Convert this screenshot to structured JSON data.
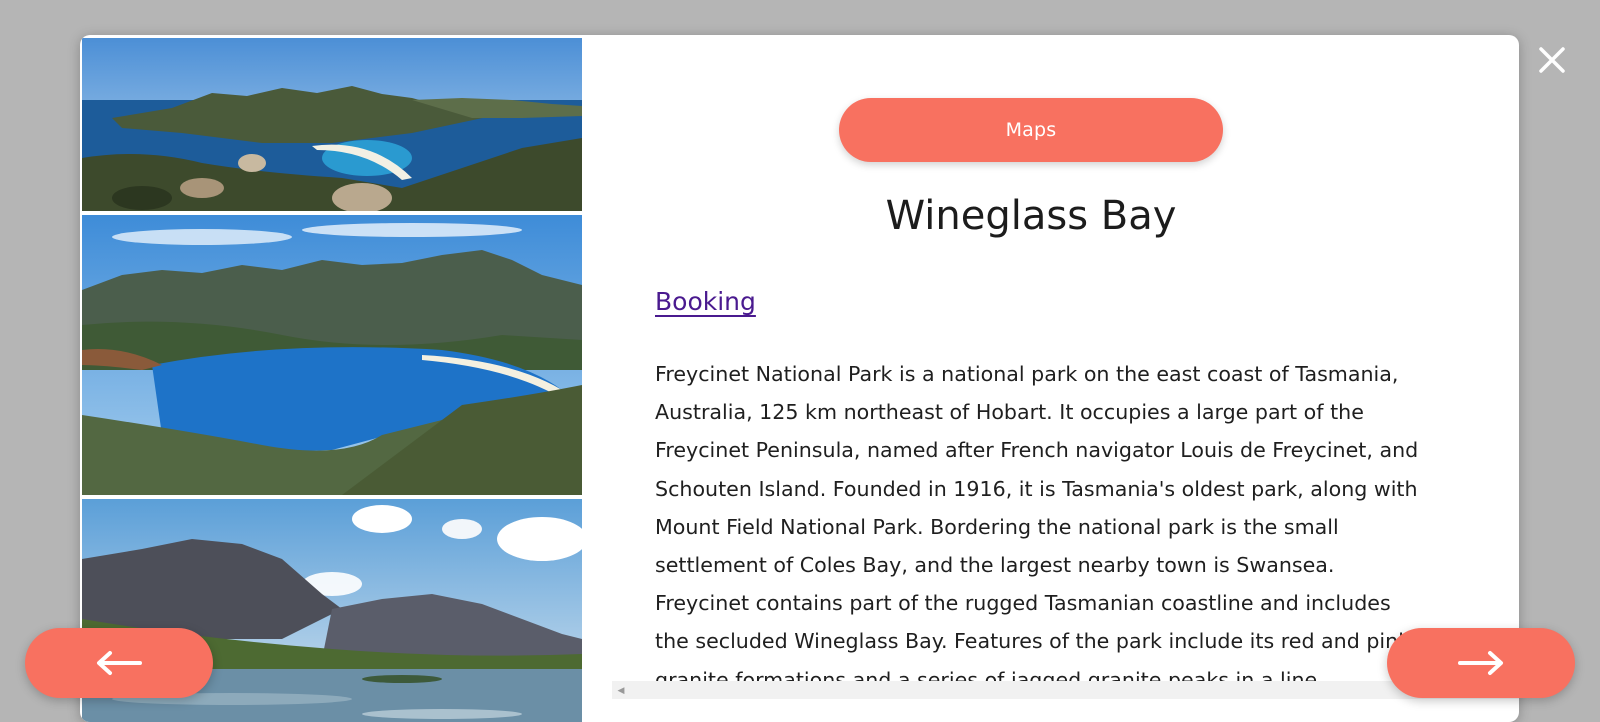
{
  "modal": {
    "maps_label": "Maps",
    "title": "Wineglass Bay",
    "booking_link": "Booking",
    "description": "Freycinet National Park is a national park on the east coast of Tasmania, Australia, 125 km northeast of Hobart. It occupies a large part of the Freycinet Peninsula, named after French navigator Louis de Freycinet, and Schouten Island. Founded in 1916, it is Tasmania's oldest park, along with Mount Field National Park. Bordering the national park is the small settlement of Coles Bay, and the largest nearby town is Swansea. Freycinet contains part of the rugged Tasmanian coastline and includes the secluded Wineglass Bay. Features of the park include its red and pink granite formations and a series of jagged granite peaks in a line."
  },
  "controls": {
    "close_icon": "close-icon",
    "prev_icon": "arrow-left-icon",
    "next_icon": "arrow-right-icon"
  },
  "colors": {
    "accent": "#f87160",
    "link": "#4a1a8f",
    "overlay": "#b5b5b5"
  }
}
